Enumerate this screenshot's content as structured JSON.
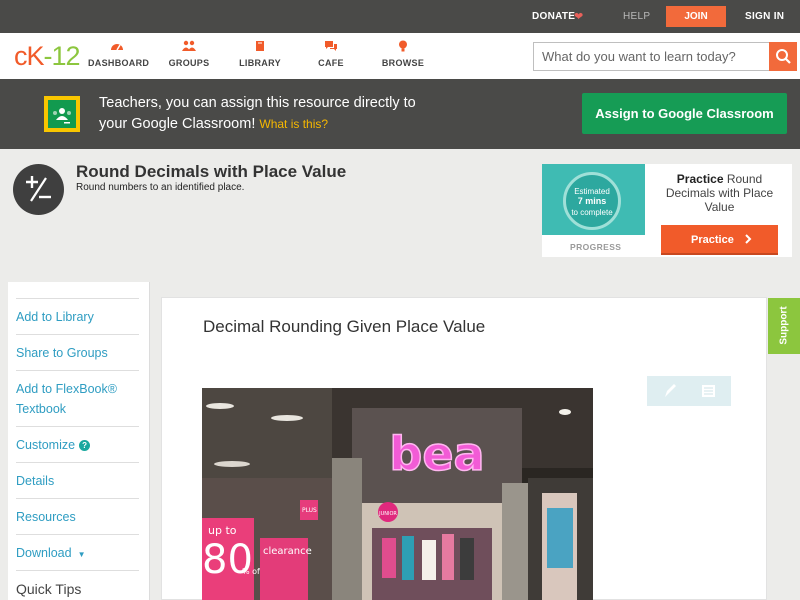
{
  "topbar": {
    "donate": "DONATE",
    "help": "HELP",
    "join": "JOIN",
    "signin": "SIGN IN"
  },
  "logo": {
    "part1": "c",
    "part2": "K",
    "part3": "-",
    "part4": "12"
  },
  "nav": {
    "items": [
      {
        "label": "DASHBOARD",
        "icon": "dashboard-icon"
      },
      {
        "label": "GROUPS",
        "icon": "groups-icon"
      },
      {
        "label": "LIBRARY",
        "icon": "library-icon"
      },
      {
        "label": "CAFE",
        "icon": "cafe-icon"
      },
      {
        "label": "BROWSE",
        "icon": "browse-icon"
      }
    ],
    "search_placeholder": "What do you want to learn today?"
  },
  "banner": {
    "text": "Teachers, you can assign this resource directly to your Google Classroom!",
    "what_link": "What is this?",
    "assign_button": "Assign to Google Classroom"
  },
  "header": {
    "title": "Round Decimals with Place Value",
    "subtitle": "Round numbers to an identified place."
  },
  "practice": {
    "estimated": "Estimated",
    "mins": "7 mins",
    "complete": "to complete",
    "progress_label": "PROGRESS",
    "title_bold": "Practice",
    "title_rest": " Round Decimals with Place Value",
    "button": "Practice"
  },
  "sidebar": {
    "items": [
      {
        "label": "Add to Library"
      },
      {
        "label": "Share to Groups"
      },
      {
        "label": "Add to FlexBook® Textbook"
      },
      {
        "label": "Customize"
      },
      {
        "label": "Details"
      },
      {
        "label": "Resources"
      },
      {
        "label": "Download"
      },
      {
        "label": "Quick Tips"
      }
    ]
  },
  "content": {
    "title": "Decimal Rounding Given Place Value",
    "photo": {
      "sign": "bea",
      "sale_top": "up to",
      "sale_big": "80",
      "sale_off": "% off",
      "clearance": "clearance",
      "plus": "PLUS",
      "junior": "JUNIOR"
    }
  },
  "support_tab": "Support",
  "colors": {
    "accent_orange": "#f26a3b",
    "dark_bar": "#4a4a48",
    "link_blue": "#2f9dc2",
    "classroom_green": "#169c55",
    "support_green": "#8cc63e"
  }
}
